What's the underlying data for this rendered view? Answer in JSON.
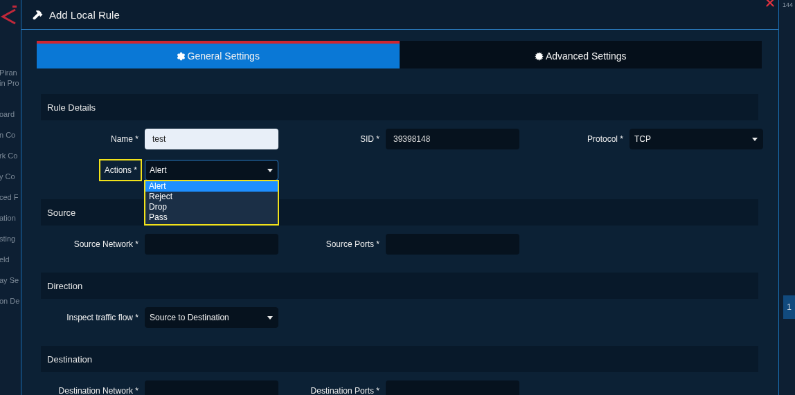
{
  "background": {
    "sidebar_items": [
      "Piran",
      "in Pro",
      "oard",
      "n Co",
      "rk Co",
      "y Co",
      "ced F",
      "ation",
      "sting",
      "eld",
      "ay Se",
      "on De"
    ],
    "top_counter": "144",
    "page_number": "1"
  },
  "dialog": {
    "title": "Add Local Rule",
    "tabs": [
      {
        "label": "General Settings",
        "selected": true
      },
      {
        "label": "Advanced Settings",
        "selected": false
      }
    ],
    "sections": [
      {
        "title": "Rule Details",
        "rows": [
          [
            {
              "kind": "input",
              "label": "Name *",
              "value": "test",
              "autofilled": true
            },
            {
              "kind": "input",
              "label": "SID *",
              "value": "39398148",
              "autofilled": false
            },
            {
              "kind": "select",
              "label": "Protocol *",
              "value": "TCP"
            }
          ],
          [
            {
              "kind": "select",
              "label": "Actions *",
              "value": "Alert",
              "highlighted": true,
              "expanded": true,
              "options": [
                {
                  "label": "Alert",
                  "selected": true
                },
                {
                  "label": "Reject",
                  "selected": false
                },
                {
                  "label": "Drop",
                  "selected": false
                },
                {
                  "label": "Pass",
                  "selected": false
                }
              ]
            }
          ]
        ]
      },
      {
        "title": "Source",
        "rows": [
          [
            {
              "kind": "input",
              "label": "Source Network *",
              "autofilled": false
            },
            {
              "kind": "input",
              "label": "Source Ports *",
              "autofilled": false
            }
          ]
        ]
      },
      {
        "title": "Direction",
        "rows": [
          [
            {
              "kind": "select",
              "label": "Inspect traffic flow *",
              "value": "Source to Destination"
            }
          ]
        ]
      },
      {
        "title": "Destination",
        "rows": [
          [
            {
              "kind": "input",
              "label": "Destination Network *",
              "autofilled": false
            },
            {
              "kind": "input",
              "label": "Destination Ports *",
              "autofilled": false
            }
          ]
        ]
      }
    ]
  }
}
